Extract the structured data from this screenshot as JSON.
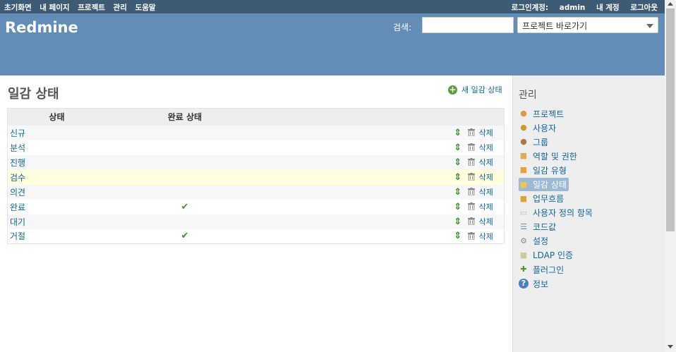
{
  "top_menu": {
    "items": [
      "초기화면",
      "내 페이지",
      "프로젝트",
      "관리",
      "도움말"
    ],
    "logged_as_label": "로그인계정:",
    "user": "admin",
    "my_account": "내 계정",
    "logout": "로그아웃"
  },
  "header": {
    "app_title": "Redmine",
    "search_label": "검색:",
    "search_value": "",
    "project_jump": "프로젝트 바로가기"
  },
  "main": {
    "title": "일감 상태",
    "new_link": "새 일감 상태",
    "columns": [
      "상태",
      "완료 상태"
    ],
    "rows": [
      {
        "name": "신규",
        "closed": false,
        "delete": "삭제"
      },
      {
        "name": "분석",
        "closed": false,
        "delete": "삭제"
      },
      {
        "name": "진행",
        "closed": false,
        "delete": "삭제"
      },
      {
        "name": "검수",
        "closed": false,
        "delete": "삭제"
      },
      {
        "name": "의견",
        "closed": false,
        "delete": "삭제"
      },
      {
        "name": "완료",
        "closed": true,
        "delete": "삭제"
      },
      {
        "name": "대기",
        "closed": false,
        "delete": "삭제"
      },
      {
        "name": "거절",
        "closed": true,
        "delete": "삭제"
      }
    ]
  },
  "sidebar": {
    "title": "관리",
    "items": [
      {
        "label": "프로젝트",
        "icon": "projects-icon"
      },
      {
        "label": "사용자",
        "icon": "user-icon"
      },
      {
        "label": "그룹",
        "icon": "group-icon"
      },
      {
        "label": "역할 및 권한",
        "icon": "roles-icon"
      },
      {
        "label": "일감 유형",
        "icon": "tracker-icon"
      },
      {
        "label": "일감 상태",
        "icon": "issue-status-icon",
        "selected": true
      },
      {
        "label": "업무흐름",
        "icon": "workflow-icon"
      },
      {
        "label": "사용자 정의 항목",
        "icon": "custom-field-icon"
      },
      {
        "label": "코드값",
        "icon": "list-icon"
      },
      {
        "label": "설정",
        "icon": "settings-icon"
      },
      {
        "label": "LDAP 인증",
        "icon": "ldap-icon"
      },
      {
        "label": "플러그인",
        "icon": "plugin-icon"
      },
      {
        "label": "정보",
        "icon": "info-icon"
      }
    ]
  },
  "colors": {
    "top_menu_bg": "#3E5B76",
    "header_bg": "#628DB6",
    "link": "#169",
    "highlight_row": "#ffffdd",
    "sidebar_bg": "#eee",
    "selected_item": "#9DB9D5"
  }
}
